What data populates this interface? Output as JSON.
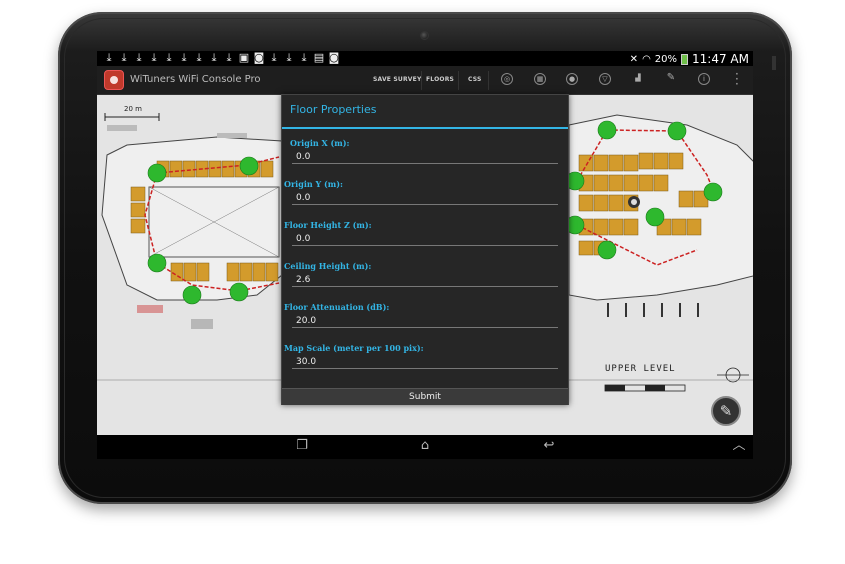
{
  "status_bar": {
    "battery": "20%",
    "time": "11:47 AM",
    "notifications": [
      "download-icon",
      "download-icon",
      "download-icon",
      "download-icon",
      "download-icon",
      "download-icon",
      "download-icon",
      "download-icon",
      "download-icon",
      "image-icon",
      "camera-icon",
      "download-icon",
      "download-icon",
      "download-icon",
      "gallery-icon",
      "camera-icon"
    ]
  },
  "action_bar": {
    "app_title": "WiTuners WiFi Console Pro",
    "actions": [
      "SAVE SURVEY",
      "FLOORS",
      "CSS"
    ]
  },
  "map": {
    "scale_label": "20 m",
    "level_label": "UPPER LEVEL"
  },
  "dialog": {
    "title": "Floor Properties",
    "fields": [
      {
        "label": "Origin X (m):",
        "value": "0.0"
      },
      {
        "label": "Origin Y (m):",
        "value": "0.0"
      },
      {
        "label": "Floor Height Z (m):",
        "value": "0.0"
      },
      {
        "label": "Ceiling Height (m):",
        "value": "2.6"
      },
      {
        "label": "Floor Attenuation (dB):",
        "value": "20.0"
      },
      {
        "label": "Map Scale (meter per 100 pix):",
        "value": "30.0"
      }
    ],
    "submit_label": "Submit"
  },
  "colors": {
    "accent": "#33b5e5",
    "ap_marker": "#2eb82e",
    "path": "#cc2222",
    "booth": "#d39b2c"
  }
}
